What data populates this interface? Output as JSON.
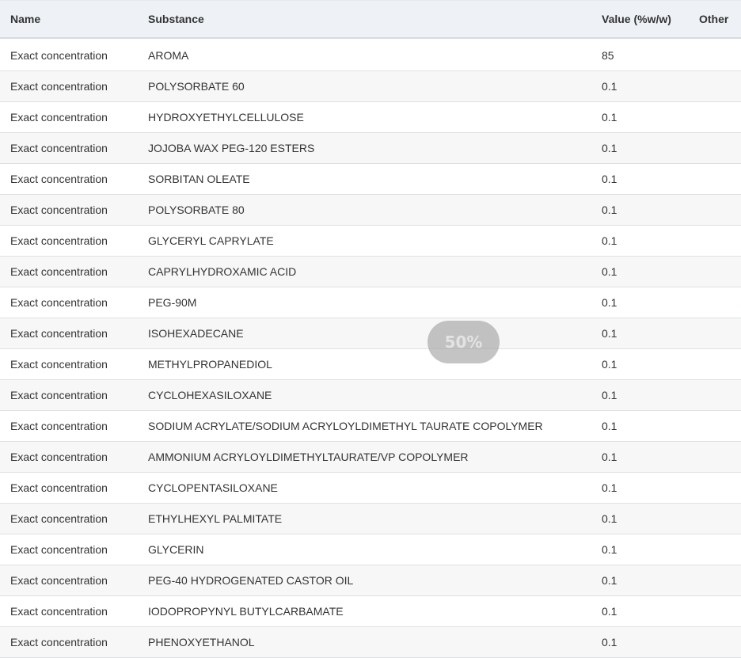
{
  "header": {
    "name": "Name",
    "substance": "Substance",
    "value": "Value (%w/w)",
    "other": "Other"
  },
  "zoom_level": "50%",
  "rows": [
    {
      "name": "Exact concentration",
      "substance": "AROMA",
      "value": "85",
      "other": ""
    },
    {
      "name": "Exact concentration",
      "substance": "POLYSORBATE 60",
      "value": "0.1",
      "other": ""
    },
    {
      "name": "Exact concentration",
      "substance": "HYDROXYETHYLCELLULOSE",
      "value": "0.1",
      "other": ""
    },
    {
      "name": "Exact concentration",
      "substance": "JOJOBA WAX PEG-120 ESTERS",
      "value": "0.1",
      "other": ""
    },
    {
      "name": "Exact concentration",
      "substance": "SORBITAN OLEATE",
      "value": "0.1",
      "other": ""
    },
    {
      "name": "Exact concentration",
      "substance": "POLYSORBATE 80",
      "value": "0.1",
      "other": ""
    },
    {
      "name": "Exact concentration",
      "substance": "GLYCERYL CAPRYLATE",
      "value": "0.1",
      "other": ""
    },
    {
      "name": "Exact concentration",
      "substance": "CAPRYLHYDROXAMIC ACID",
      "value": "0.1",
      "other": ""
    },
    {
      "name": "Exact concentration",
      "substance": "PEG-90M",
      "value": "0.1",
      "other": ""
    },
    {
      "name": "Exact concentration",
      "substance": "ISOHEXADECANE",
      "value": "0.1",
      "other": ""
    },
    {
      "name": "Exact concentration",
      "substance": "METHYLPROPANEDIOL",
      "value": "0.1",
      "other": ""
    },
    {
      "name": "Exact concentration",
      "substance": "CYCLOHEXASILOXANE",
      "value": "0.1",
      "other": ""
    },
    {
      "name": "Exact concentration",
      "substance": "SODIUM ACRYLATE/SODIUM ACRYLOYLDIMETHYL TAURATE COPOLYMER",
      "value": "0.1",
      "other": ""
    },
    {
      "name": "Exact concentration",
      "substance": "AMMONIUM ACRYLOYLDIMETHYLTAURATE/VP COPOLYMER",
      "value": "0.1",
      "other": ""
    },
    {
      "name": "Exact concentration",
      "substance": "CYCLOPENTASILOXANE",
      "value": "0.1",
      "other": ""
    },
    {
      "name": "Exact concentration",
      "substance": "ETHYLHEXYL PALMITATE",
      "value": "0.1",
      "other": ""
    },
    {
      "name": "Exact concentration",
      "substance": "GLYCERIN",
      "value": "0.1",
      "other": ""
    },
    {
      "name": "Exact concentration",
      "substance": "PEG-40 HYDROGENATED CASTOR OIL",
      "value": "0.1",
      "other": ""
    },
    {
      "name": "Exact concentration",
      "substance": "IODOPROPYNYL BUTYLCARBAMATE",
      "value": "0.1",
      "other": ""
    },
    {
      "name": "Exact concentration",
      "substance": "PHENOXYETHANOL",
      "value": "0.1",
      "other": ""
    }
  ]
}
